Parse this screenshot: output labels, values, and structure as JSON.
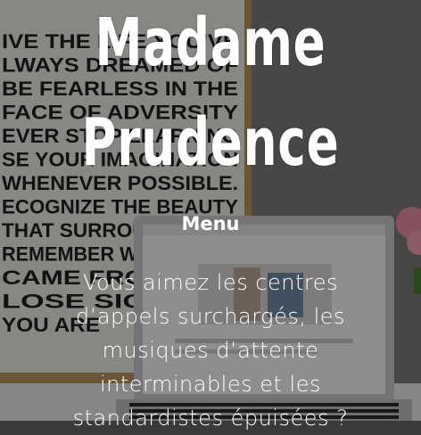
{
  "site": {
    "title_line1": "Madame",
    "title_line2": "Prudence"
  },
  "nav": {
    "menu_label": "Menu"
  },
  "intro": {
    "text": "Vous aimez les centres d’appels surchargés, les musiques d’attente interminables et les standardistes épuisées ?"
  },
  "poster": {
    "lines": [
      "IVE THE LIFE YOU'VE",
      "LWAYS DREAMED OF",
      "BE FEARLESS IN THE",
      "FACE OF ADVERSITY",
      "EVER STOP LEARNING",
      "SE YOUR IMAGINATION",
      "WHENEVER POSSIBLE.",
      "ECOGNIZE THE BEAUTY",
      "THAT SURROUNDS YOU",
      "REMEMBER WHERE YOU",
      "CAME FROM. BUT",
      "LOSE SIGHT OF",
      "YOU ARE"
    ]
  },
  "colors": {
    "overlay": "#000000",
    "text": "#ffffff",
    "wall": "#6e6e6e",
    "poster_frame": "#b8935a",
    "poster_bg": "#eeeeea"
  }
}
